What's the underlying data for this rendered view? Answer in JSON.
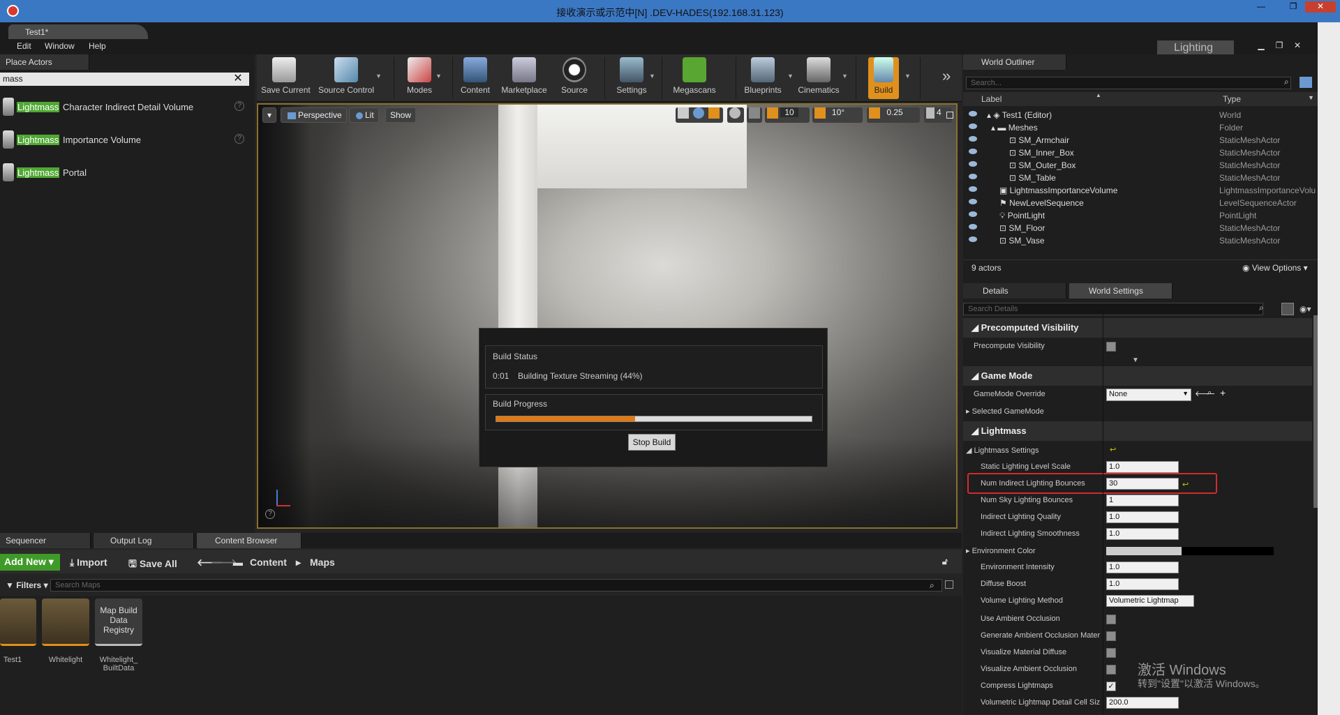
{
  "window": {
    "title": "接收演示或示范中[N] .DEV-HADES(192.168.31.123)"
  },
  "doc_tab": "Test1*",
  "menu": [
    "Edit",
    "Window",
    "Help"
  ],
  "lighting_badge": "Lighting",
  "left_panel": {
    "tab": "Place Actors",
    "search_value": "mass",
    "highlight": "Lightmass",
    "items": [
      " Character Indirect Detail Volume",
      " Importance Volume",
      " Portal"
    ]
  },
  "toolbar": {
    "buttons": [
      "Save Current",
      "Source Control",
      "Modes",
      "Content",
      "Marketplace",
      "Source",
      "Settings",
      "Megascans",
      "Blueprints",
      "Cinematics",
      "Build"
    ],
    "overflow": "»"
  },
  "viewport": {
    "perspective": "Perspective",
    "lit": "Lit",
    "show": "Show",
    "grid_snap": "10",
    "rot_snap": "10°",
    "scale_snap": "0.25",
    "camera_speed": "4"
  },
  "build": {
    "status_title": "Build Status",
    "time": "0:01",
    "status_text": "Building Texture Streaming (44%)",
    "progress_title": "Build Progress",
    "progress": 0.44,
    "stop_label": "Stop Build"
  },
  "bottom_tabs": [
    "Sequencer",
    "Output Log",
    "Content Browser"
  ],
  "content_browser": {
    "add_new": "Add New",
    "import": "Import",
    "save_all": "Save All",
    "path": [
      "Content",
      "Maps"
    ],
    "filters": "Filters",
    "search_placeholder": "Search Maps",
    "assets": [
      {
        "label": "Test1"
      },
      {
        "label": "Whitelight"
      },
      {
        "label": "Whitelight_\nBuiltData",
        "thumb": "Map Build\nData\nRegistry"
      }
    ]
  },
  "outliner": {
    "tab": "World Outliner",
    "search_placeholder": "Search...",
    "col_label": "Label",
    "col_type": "Type",
    "rows": [
      {
        "name": "Test1 (Editor)",
        "type": "World"
      },
      {
        "name": "Meshes",
        "type": "Folder"
      },
      {
        "name": "SM_Armchair",
        "type": "StaticMeshActor"
      },
      {
        "name": "SM_Inner_Box",
        "type": "StaticMeshActor"
      },
      {
        "name": "SM_Outer_Box",
        "type": "StaticMeshActor"
      },
      {
        "name": "SM_Table",
        "type": "StaticMeshActor"
      },
      {
        "name": "LightmassImportanceVolume",
        "type": "LightmassImportanceVolu"
      },
      {
        "name": "NewLevelSequence",
        "type": "LevelSequenceActor"
      },
      {
        "name": "PointLight",
        "type": "PointLight"
      },
      {
        "name": "SM_Floor",
        "type": "StaticMeshActor"
      },
      {
        "name": "SM_Vase",
        "type": "StaticMeshActor"
      }
    ],
    "count": "9 actors",
    "view_options": "View Options"
  },
  "details": {
    "tabs": [
      "Details",
      "World Settings"
    ],
    "search_placeholder": "Search Details",
    "sections": {
      "precomputed": "Precomputed Visibility",
      "precompute_label": "Precompute Visibility",
      "game_mode": "Game Mode",
      "gamemode_override": "GameMode Override",
      "gamemode_value": "None",
      "selected_gamemode": "Selected GameMode",
      "lightmass": "Lightmass",
      "lightmass_settings": "Lightmass Settings"
    },
    "props": [
      {
        "label": "Static Lighting Level Scale",
        "value": "1.0"
      },
      {
        "label": "Num Indirect Lighting Bounces",
        "value": "30"
      },
      {
        "label": "Num Sky Lighting Bounces",
        "value": "1"
      },
      {
        "label": "Indirect Lighting Quality",
        "value": "1.0"
      },
      {
        "label": "Indirect Lighting Smoothness",
        "value": "1.0"
      },
      {
        "label": "Environment Color",
        "value": ""
      },
      {
        "label": "Environment Intensity",
        "value": "1.0"
      },
      {
        "label": "Diffuse Boost",
        "value": "1.0"
      },
      {
        "label": "Volume Lighting Method",
        "value": "Volumetric Lightmap"
      },
      {
        "label": "Use Ambient Occlusion",
        "value": ""
      },
      {
        "label": "Generate Ambient Occlusion Mater",
        "value": ""
      },
      {
        "label": "Visualize Material Diffuse",
        "value": ""
      },
      {
        "label": "Visualize Ambient Occlusion",
        "value": ""
      },
      {
        "label": "Compress Lightmaps",
        "value": ""
      },
      {
        "label": "Volumetric Lightmap Detail Cell Siz",
        "value": "200.0"
      }
    ]
  },
  "watermark": {
    "line1": "激活 Windows",
    "line2": "转到\"设置\"以激活 Windows。"
  }
}
